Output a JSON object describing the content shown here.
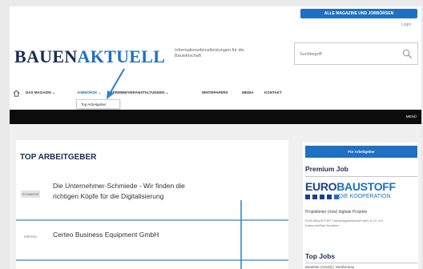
{
  "header": {
    "promo_button": "ALLE MAGAZINE UND JOBBÖRSEN",
    "login": "Login",
    "logo_part1": "BAUEN",
    "logo_part2": "AKTUELL",
    "tagline": "Informationsdienstleistungen für die Bauwirtschaft",
    "search_placeholder": "Suchbegriff"
  },
  "nav": {
    "items": [
      {
        "label": "DAS MAGAZIN ⌄"
      },
      {
        "label": "JOBBÖRSE ⌄"
      },
      {
        "label": "TERMINE/VERANSTALTUNGEN ⌄"
      },
      {
        "label": "WHITEPAPERS"
      },
      {
        "label": "MEDIA"
      },
      {
        "label": "KONTAKT"
      }
    ],
    "active_index": 1,
    "dropdown_item": "Top Arbeitgeber",
    "menu_label": "MENÜ"
  },
  "main": {
    "title": "TOP ARBEITGEBER",
    "employers": [
      {
        "logo_text": "SCHMIEDE",
        "name_line1": "Die Unternehmer-Schmiede - Wir finden die",
        "name_line2": "richtigen Köpfe für die Digitalisierung"
      },
      {
        "logo_text": "CERTEO",
        "name_line1": "Certeo Business Equipment GmbH",
        "name_line2": ""
      }
    ]
  },
  "sidebar": {
    "button": "Für Arbeitgeber",
    "premium_heading": "Premium Job",
    "euro_logo_1": "EURO",
    "euro_logo_2": "BAUSTOFF",
    "euro_logo_3": "DIE KOOPERATION",
    "job_title": "Projektleiter (m/w) digitale Projekte",
    "job_desc": "EUROBAUSTOFF Handelsgesellschaft mbH & Co. KG, Karlsruhe/Bad Nauheim",
    "top_jobs_heading": "Top Jobs",
    "top_jobs_tag": "Bauleiter (m/w/d) | Straßenbau"
  },
  "colors": {
    "accent": "#1f6fc2",
    "dark_navy": "#1d2a55",
    "separator": "#7fb2d6"
  }
}
